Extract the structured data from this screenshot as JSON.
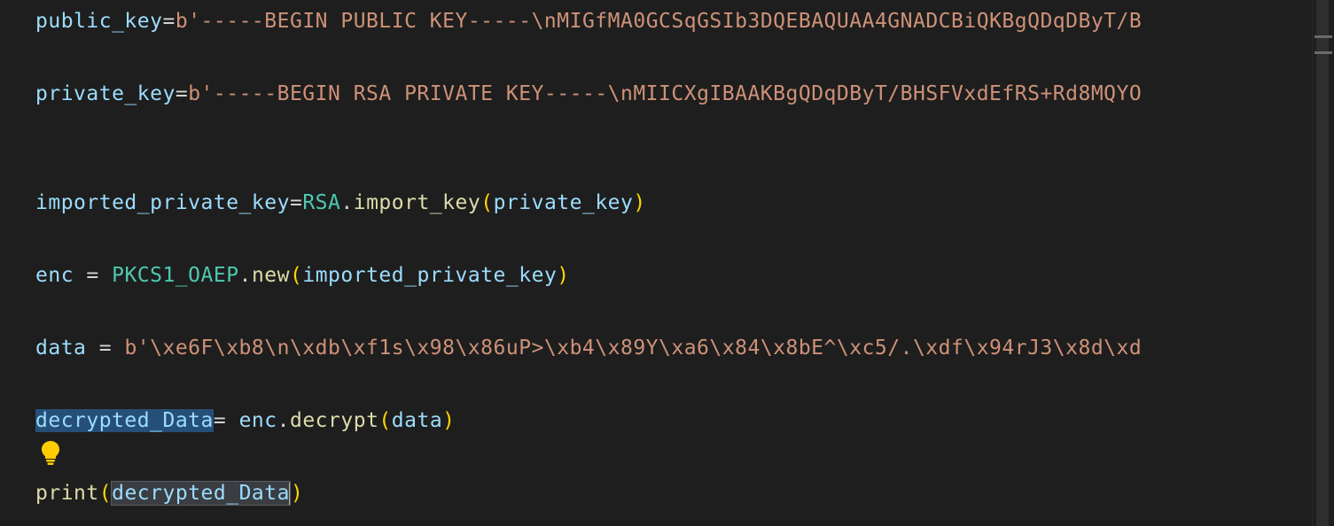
{
  "editor": {
    "lines": {
      "public_key": {
        "name": "public_key",
        "op": "=",
        "value": "b'-----BEGIN PUBLIC KEY-----\\nMIGfMA0GCSqGSIb3DQEBAQUAA4GNADCBiQKBgQDqDByT/B"
      },
      "private_key": {
        "name": "private_key",
        "op": "=",
        "value": "b'-----BEGIN RSA PRIVATE KEY-----\\nMIICXgIBAAKBgQDqDByT/BHSFVxdEfRS+Rd8MQYO"
      },
      "import_line": {
        "name": "imported_private_key",
        "op": "=",
        "cls": "RSA",
        "dot": ".",
        "fn": "import_key",
        "open": "(",
        "arg": "private_key",
        "close": ")"
      },
      "enc_line": {
        "name": "enc",
        "op": " = ",
        "cls": "PKCS1_OAEP",
        "dot": ".",
        "fn": "new",
        "open": "(",
        "arg": "imported_private_key",
        "close": ")"
      },
      "data_line": {
        "name": "data",
        "op": " = ",
        "value": "b'\\xe6F\\xb8\\n\\xdb\\xf1s\\x98\\x86uP>\\xb4\\x89Y\\xa6\\x84\\x8bE^\\xc5/.\\xdf\\x94rJ3\\x8d\\xd"
      },
      "decrypt_line": {
        "name": "decrypted_Data",
        "op": "= ",
        "obj": "enc",
        "dot": ".",
        "fn": "decrypt",
        "open": "(",
        "arg": "data",
        "close": ")"
      },
      "print_line": {
        "fn": "print",
        "open": "(",
        "arg": "decrypted_Data",
        "close": ")"
      }
    },
    "icons": {
      "lightbulb": "lightbulb-icon"
    },
    "colors": {
      "background": "#1e1e1e",
      "variable": "#9cdcfe",
      "string": "#ce9178",
      "class": "#4ec9b0",
      "function": "#dcdcaa",
      "bracket": "#ffd700",
      "word_highlight": "#264f78"
    }
  }
}
